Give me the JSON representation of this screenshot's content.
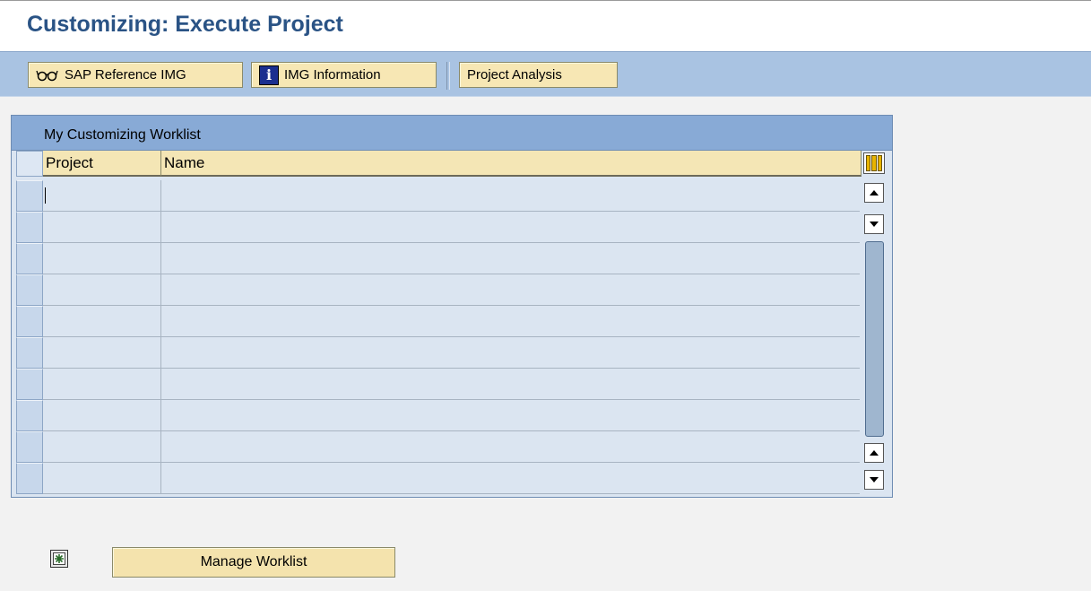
{
  "title": "Customizing: Execute Project",
  "toolbar": {
    "sap_reference_img": "SAP Reference IMG",
    "img_information": "IMG Information",
    "project_analysis": "Project Analysis",
    "icons": [
      "glasses-icon",
      "info-icon"
    ]
  },
  "worklist": {
    "header": "My Customizing Worklist",
    "columns": [
      "Project",
      "Name"
    ],
    "rows": [
      {
        "project": "",
        "name": ""
      },
      {
        "project": "",
        "name": ""
      },
      {
        "project": "",
        "name": ""
      },
      {
        "project": "",
        "name": ""
      },
      {
        "project": "",
        "name": ""
      },
      {
        "project": "",
        "name": ""
      },
      {
        "project": "",
        "name": ""
      },
      {
        "project": "",
        "name": ""
      },
      {
        "project": "",
        "name": ""
      },
      {
        "project": "",
        "name": ""
      }
    ]
  },
  "footer": {
    "manage_worklist": "Manage Worklist",
    "new_icon": "create-entry-icon"
  },
  "colors": {
    "title": "#2a5385",
    "toolbar": "#a9c3e2",
    "button": "#f7e7b4",
    "panel_header": "#88aad6",
    "table_body": "#dbe5f1"
  }
}
